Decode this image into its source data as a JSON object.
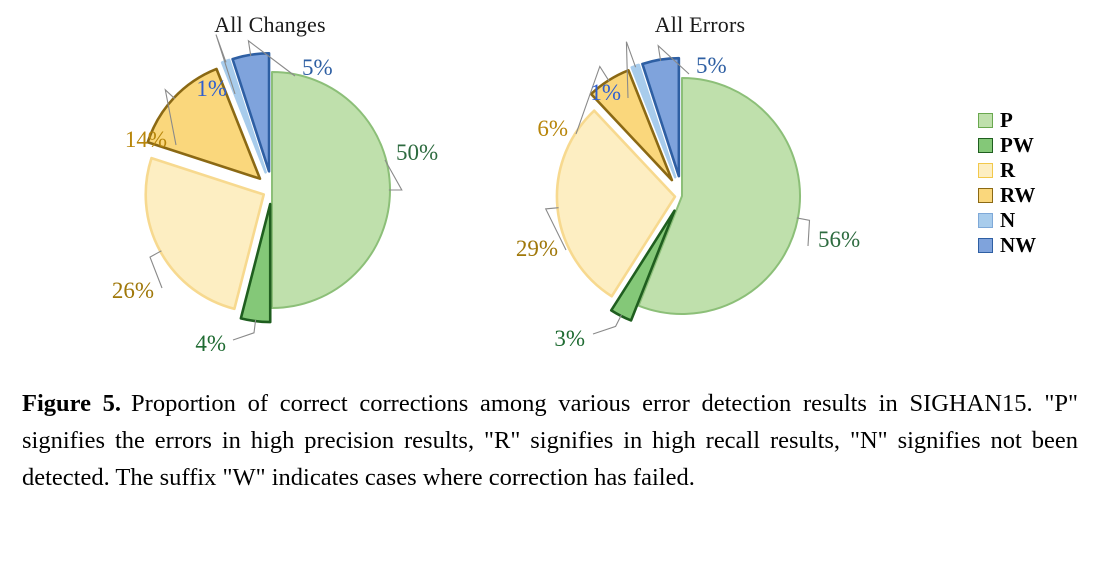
{
  "figure": {
    "caption_label": "Figure 5.",
    "caption_text": "Proportion of correct corrections among various error detection results in SIGHAN15. \"P\" signifies the errors in high precision results, \"R\" signifies in high recall results, \"N\" signifies not been detected. The suffix \"W\" indicates cases where correction has failed."
  },
  "legend": {
    "items": [
      {
        "key": "P",
        "label": "P",
        "fill": "#bfe0ac",
        "stroke": "#6aa84f"
      },
      {
        "key": "PW",
        "label": "PW",
        "fill": "#84c878",
        "stroke": "#1f5e1f"
      },
      {
        "key": "R",
        "label": "R",
        "fill": "#fdeec2",
        "stroke": "#f2c84b"
      },
      {
        "key": "RW",
        "label": "RW",
        "fill": "#fad77c",
        "stroke": "#8b6914"
      },
      {
        "key": "N",
        "label": "N",
        "fill": "#a8ccec",
        "stroke": "#7fa9d8"
      },
      {
        "key": "NW",
        "label": "NW",
        "fill": "#7fa3dc",
        "stroke": "#2e5fa3"
      }
    ]
  },
  "chart_data": [
    {
      "type": "pie",
      "title": "All Changes",
      "categories": [
        "P",
        "PW",
        "R",
        "RW",
        "N",
        "NW"
      ],
      "values": [
        50,
        4,
        26,
        14,
        1,
        5
      ],
      "labels": [
        "50%",
        "4%",
        "26%",
        "14%",
        "1%",
        "5%"
      ],
      "label_colors": [
        "#2d6b3f",
        "#1f6b32",
        "#a0780a",
        "#b8860b",
        "#2f5fd0",
        "#2e5fa3"
      ],
      "colors": [
        "#bfe0ac",
        "#84c878",
        "#fdeec2",
        "#fad77c",
        "#a8ccec",
        "#7fa3dc"
      ],
      "edge_colors": [
        "#8cbf78",
        "#1f5e1f",
        "#f7d98f",
        "#8b6914",
        "#a8ccec",
        "#2e5fa3"
      ],
      "explode": [
        0,
        0.12,
        0.08,
        0.14,
        0.16,
        0.16
      ],
      "start_angle": 90,
      "direction": "clockwise",
      "legend_position": "right"
    },
    {
      "type": "pie",
      "title": "All Errors",
      "categories": [
        "P",
        "PW",
        "R",
        "RW",
        "N",
        "NW"
      ],
      "values": [
        56,
        3,
        29,
        6,
        1,
        5
      ],
      "labels": [
        "56%",
        "3%",
        "29%",
        "6%",
        "1%",
        "5%"
      ],
      "label_colors": [
        "#2d6b3f",
        "#1f6b32",
        "#a0780a",
        "#b8860b",
        "#2f5fd0",
        "#2e5fa3"
      ],
      "colors": [
        "#bfe0ac",
        "#84c878",
        "#fdeec2",
        "#fad77c",
        "#a8ccec",
        "#7fa3dc"
      ],
      "edge_colors": [
        "#8cbf78",
        "#1f5e1f",
        "#f7d98f",
        "#8b6914",
        "#a8ccec",
        "#2e5fa3"
      ],
      "explode": [
        0,
        0.14,
        0.06,
        0.16,
        0.17,
        0.17
      ],
      "start_angle": 90,
      "direction": "clockwise",
      "legend_position": "right"
    }
  ]
}
